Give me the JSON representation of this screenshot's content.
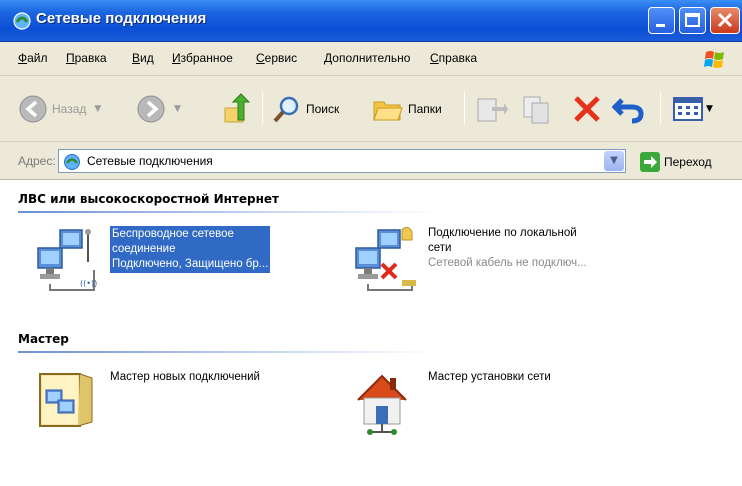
{
  "window": {
    "title": "Сетевые подключения"
  },
  "menu": [
    {
      "label": "Файл"
    },
    {
      "label": "Правка"
    },
    {
      "label": "Вид"
    },
    {
      "label": "Избранное"
    },
    {
      "label": "Сервис"
    },
    {
      "label": "Дополнительно"
    },
    {
      "label": "Справка"
    }
  ],
  "toolbar": {
    "back_label": "Назад",
    "search_label": "Поиск",
    "folders_label": "Папки"
  },
  "address": {
    "label": "Адрес:",
    "value": "Сетевые подключения",
    "go_label": "Переход"
  },
  "groups": [
    {
      "title": "ЛВС или высокоскоростной Интернет",
      "items": [
        {
          "name_line1": "Беспроводное сетевое",
          "name_line2": "соединение",
          "status": "Подключено, Защищено бр...",
          "icon": "wireless-connection-icon",
          "selected": true
        },
        {
          "name_line1": "Подключение по локальной",
          "name_line2": "сети",
          "status": "Сетевой кабель не подключ...",
          "icon": "lan-disconnected-icon",
          "selected": false
        }
      ]
    },
    {
      "title": "Мастер",
      "items": [
        {
          "name": "Мастер новых подключений",
          "icon": "new-connection-wizard-icon"
        },
        {
          "name": "Мастер установки сети",
          "icon": "network-setup-wizard-icon"
        }
      ]
    }
  ],
  "colors": {
    "titlebar": "#0b4fd6",
    "chrome": "#ece9d8",
    "selection": "#316ac5",
    "close": "#c9391b"
  }
}
